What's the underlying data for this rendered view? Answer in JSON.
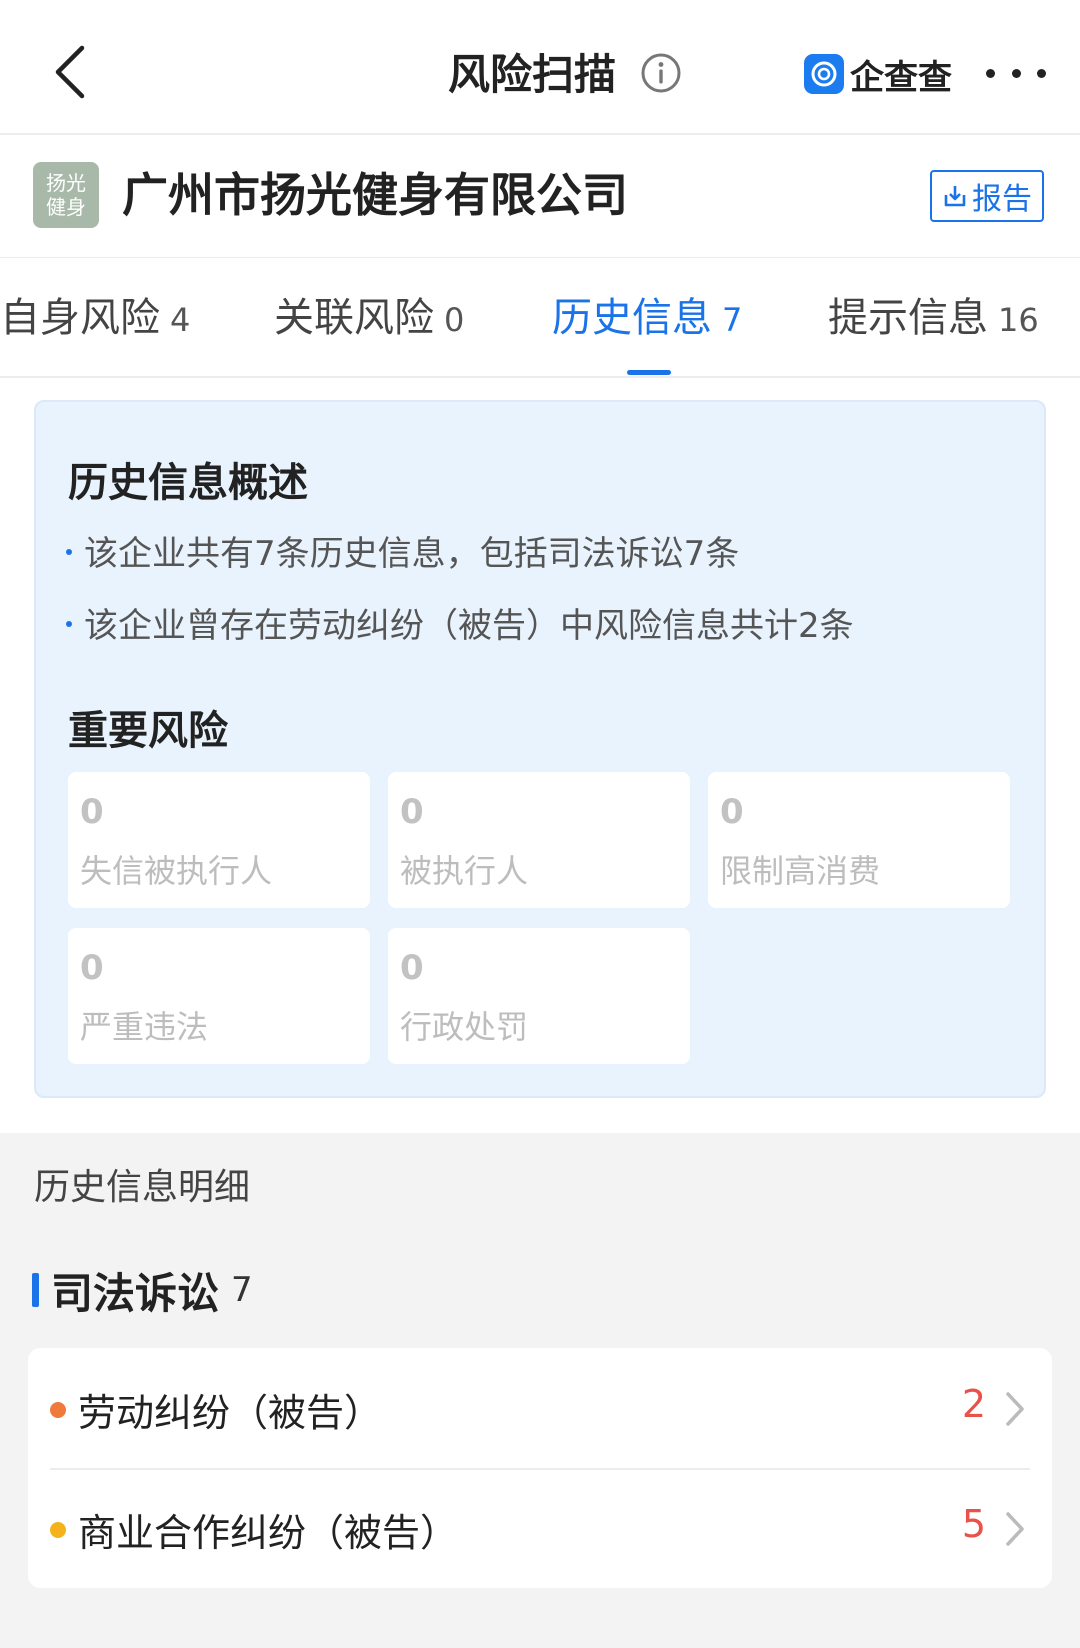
{
  "nav": {
    "title": "风险扫描",
    "brand": "企查查"
  },
  "company": {
    "logo_text": "扬光健身",
    "name": "广州市扬光健身有限公司",
    "report_label": "报告"
  },
  "tabs": [
    {
      "label": "自身风险",
      "count": "4"
    },
    {
      "label": "关联风险",
      "count": "0"
    },
    {
      "label": "历史信息",
      "count": "7"
    },
    {
      "label": "提示信息",
      "count": "16"
    }
  ],
  "overview": {
    "title": "历史信息概述",
    "lines": [
      "该企业共有7条历史信息，包括司法诉讼7条",
      "该企业曾存在劳动纠纷（被告）中风险信息共计2条"
    ],
    "risk_title": "重要风险",
    "risks": [
      {
        "value": "0",
        "label": "失信被执行人"
      },
      {
        "value": "0",
        "label": "被执行人"
      },
      {
        "value": "0",
        "label": "限制高消费"
      },
      {
        "value": "0",
        "label": "严重违法"
      },
      {
        "value": "0",
        "label": "行政处罚"
      }
    ]
  },
  "detail": {
    "heading": "历史信息明细",
    "section": {
      "title": "司法诉讼",
      "count": "7"
    },
    "items": [
      {
        "label": "劳动纠纷（被告）",
        "count": "2",
        "dot_color": "#f07a3c"
      },
      {
        "label": "商业合作纠纷（被告）",
        "count": "5",
        "dot_color": "#f5b21b"
      }
    ]
  },
  "colors": {
    "accent": "#1a73e8",
    "count_red": "#e8524a",
    "overview_bg": "#e9f3fd"
  }
}
